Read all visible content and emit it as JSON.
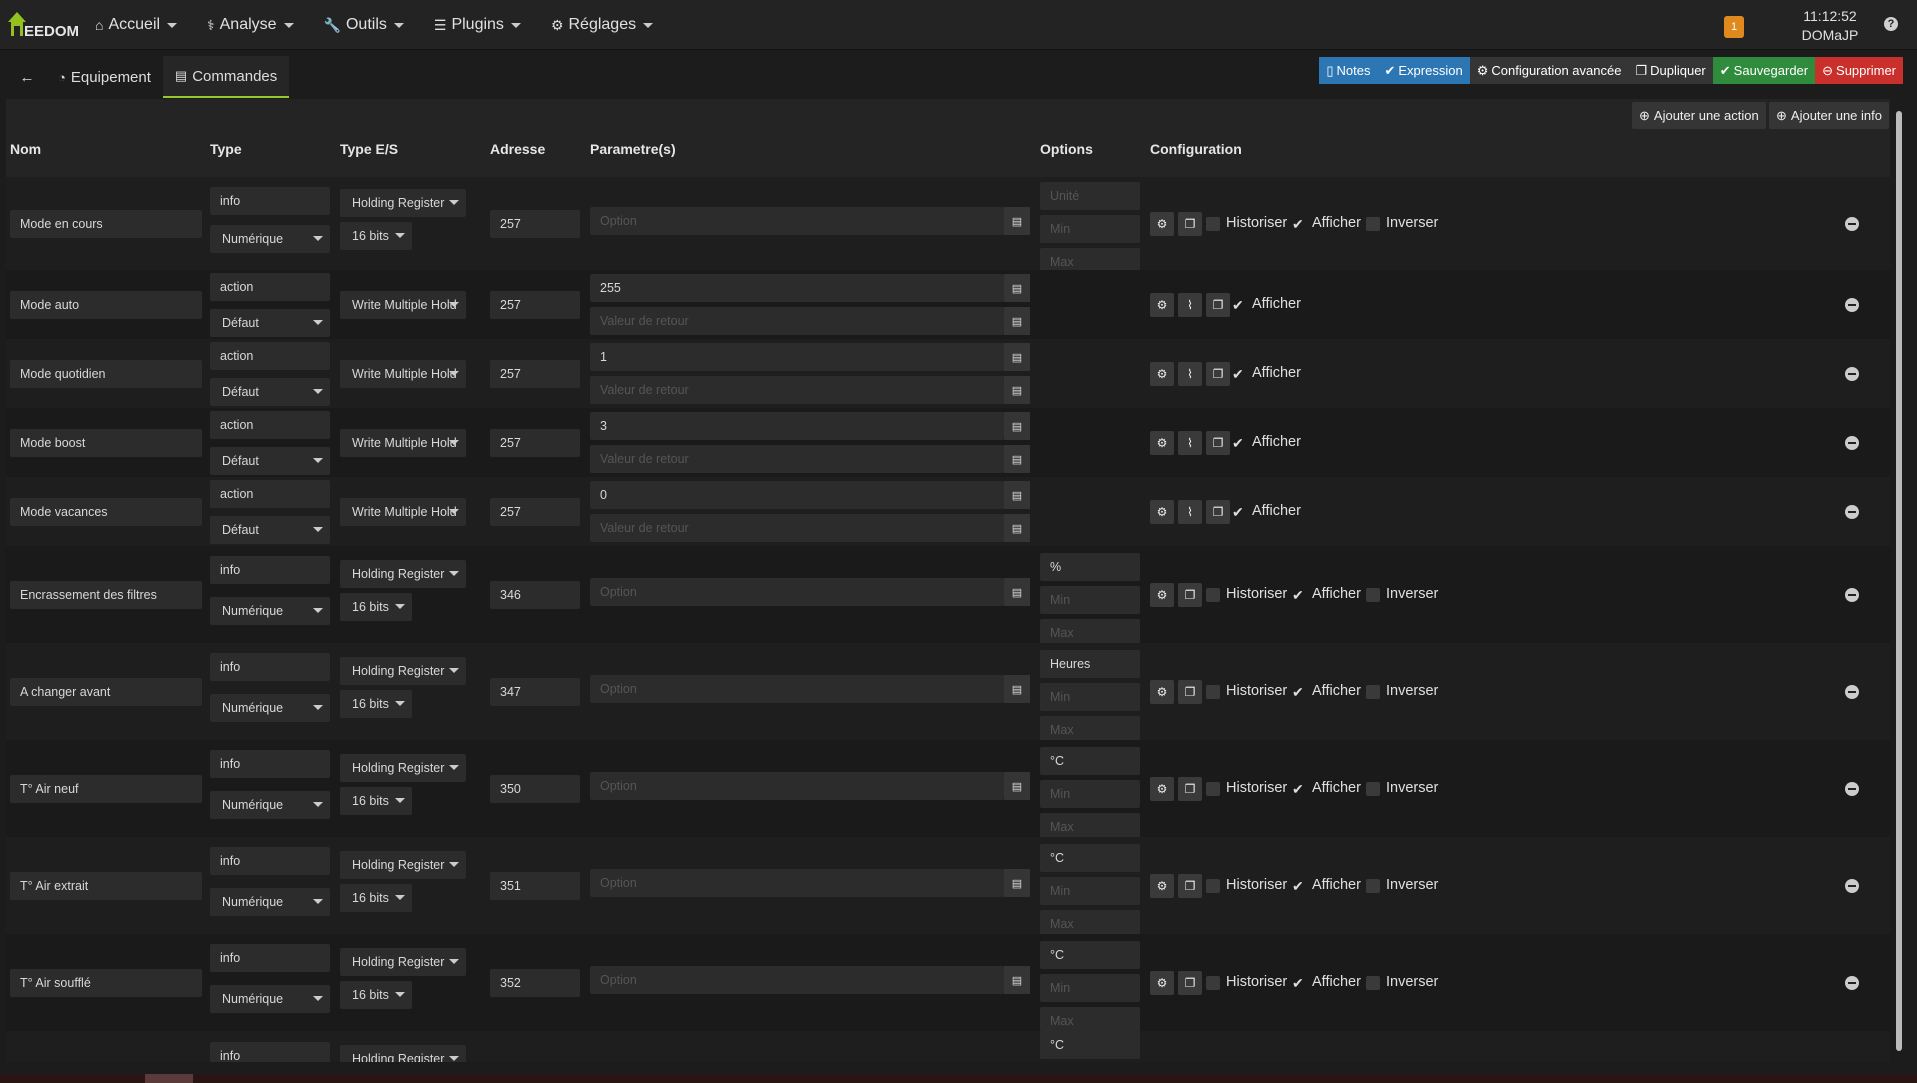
{
  "navbar": {
    "logo_text": "EEDOM",
    "menus": [
      {
        "icon": "home-icon",
        "glyph": "⌂",
        "label": "Accueil"
      },
      {
        "icon": "stethoscope-icon",
        "glyph": "⚕",
        "label": "Analyse"
      },
      {
        "icon": "wrench-icon",
        "glyph": "🔧",
        "label": "Outils"
      },
      {
        "icon": "list-icon",
        "glyph": "☰",
        "label": "Plugins"
      },
      {
        "icon": "gear-icon",
        "glyph": "⚙",
        "label": "Réglages"
      }
    ],
    "notification_count": "1",
    "time": "11:12:52",
    "user": "DOMaJP",
    "help": "?"
  },
  "tabs": {
    "back_glyph": "←",
    "equipement": "Equipement",
    "commandes": "Commandes"
  },
  "actions": {
    "notes": "Notes",
    "expression": "Expression",
    "config_avancee": "Configuration avancée",
    "dupliquer": "Dupliquer",
    "sauvegarder": "Sauvegarder",
    "supprimer": "Supprimer"
  },
  "panel": {
    "add_action": "Ajouter une action",
    "add_info": "Ajouter une info",
    "headers": {
      "nom": "Nom",
      "type": "Type",
      "type_es": "Type E/S",
      "adresse": "Adresse",
      "parametres": "Parametre(s)",
      "options": "Options",
      "configuration": "Configuration"
    }
  },
  "labels": {
    "historiser": "Historiser",
    "afficher": "Afficher",
    "inverser": "Inverser",
    "option_placeholder": "Option",
    "retour_placeholder": "Valeur de retour",
    "unite_placeholder": "Unité",
    "min_placeholder": "Min",
    "max_placeholder": "Max"
  },
  "commands": [
    {
      "kind": "info",
      "nom": "Mode en cours",
      "type": "info",
      "subtype": "Numérique",
      "io": "Holding Register",
      "bits": "16 bits",
      "adresse": "257",
      "unite": ""
    },
    {
      "kind": "action",
      "nom": "Mode auto",
      "type": "action",
      "subtype": "Défaut",
      "io": "Write Multiple Hold",
      "adresse": "257",
      "param": "255"
    },
    {
      "kind": "action",
      "nom": "Mode quotidien",
      "type": "action",
      "subtype": "Défaut",
      "io": "Write Multiple Hold",
      "adresse": "257",
      "param": "1"
    },
    {
      "kind": "action",
      "nom": "Mode boost",
      "type": "action",
      "subtype": "Défaut",
      "io": "Write Multiple Hold",
      "adresse": "257",
      "param": "3"
    },
    {
      "kind": "action",
      "nom": "Mode vacances",
      "type": "action",
      "subtype": "Défaut",
      "io": "Write Multiple Hold",
      "adresse": "257",
      "param": "0"
    },
    {
      "kind": "info",
      "nom": "Encrassement des filtres",
      "type": "info",
      "subtype": "Numérique",
      "io": "Holding Register",
      "bits": "16 bits",
      "adresse": "346",
      "unite": "%"
    },
    {
      "kind": "info",
      "nom": "A changer avant",
      "type": "info",
      "subtype": "Numérique",
      "io": "Holding Register",
      "bits": "16 bits",
      "adresse": "347",
      "unite": "Heures"
    },
    {
      "kind": "info",
      "nom": "T° Air neuf",
      "type": "info",
      "subtype": "Numérique",
      "io": "Holding Register",
      "bits": "16 bits",
      "adresse": "350",
      "unite": "°C"
    },
    {
      "kind": "info",
      "nom": "T° Air extrait",
      "type": "info",
      "subtype": "Numérique",
      "io": "Holding Register",
      "bits": "16 bits",
      "adresse": "351",
      "unite": "°C"
    },
    {
      "kind": "info",
      "nom": "T° Air soufflé",
      "type": "info",
      "subtype": "Numérique",
      "io": "Holding Register",
      "bits": "16 bits",
      "adresse": "352",
      "unite": "°C"
    },
    {
      "kind": "partial",
      "type": "info",
      "io": "Holding Register",
      "unite": "°C"
    }
  ]
}
